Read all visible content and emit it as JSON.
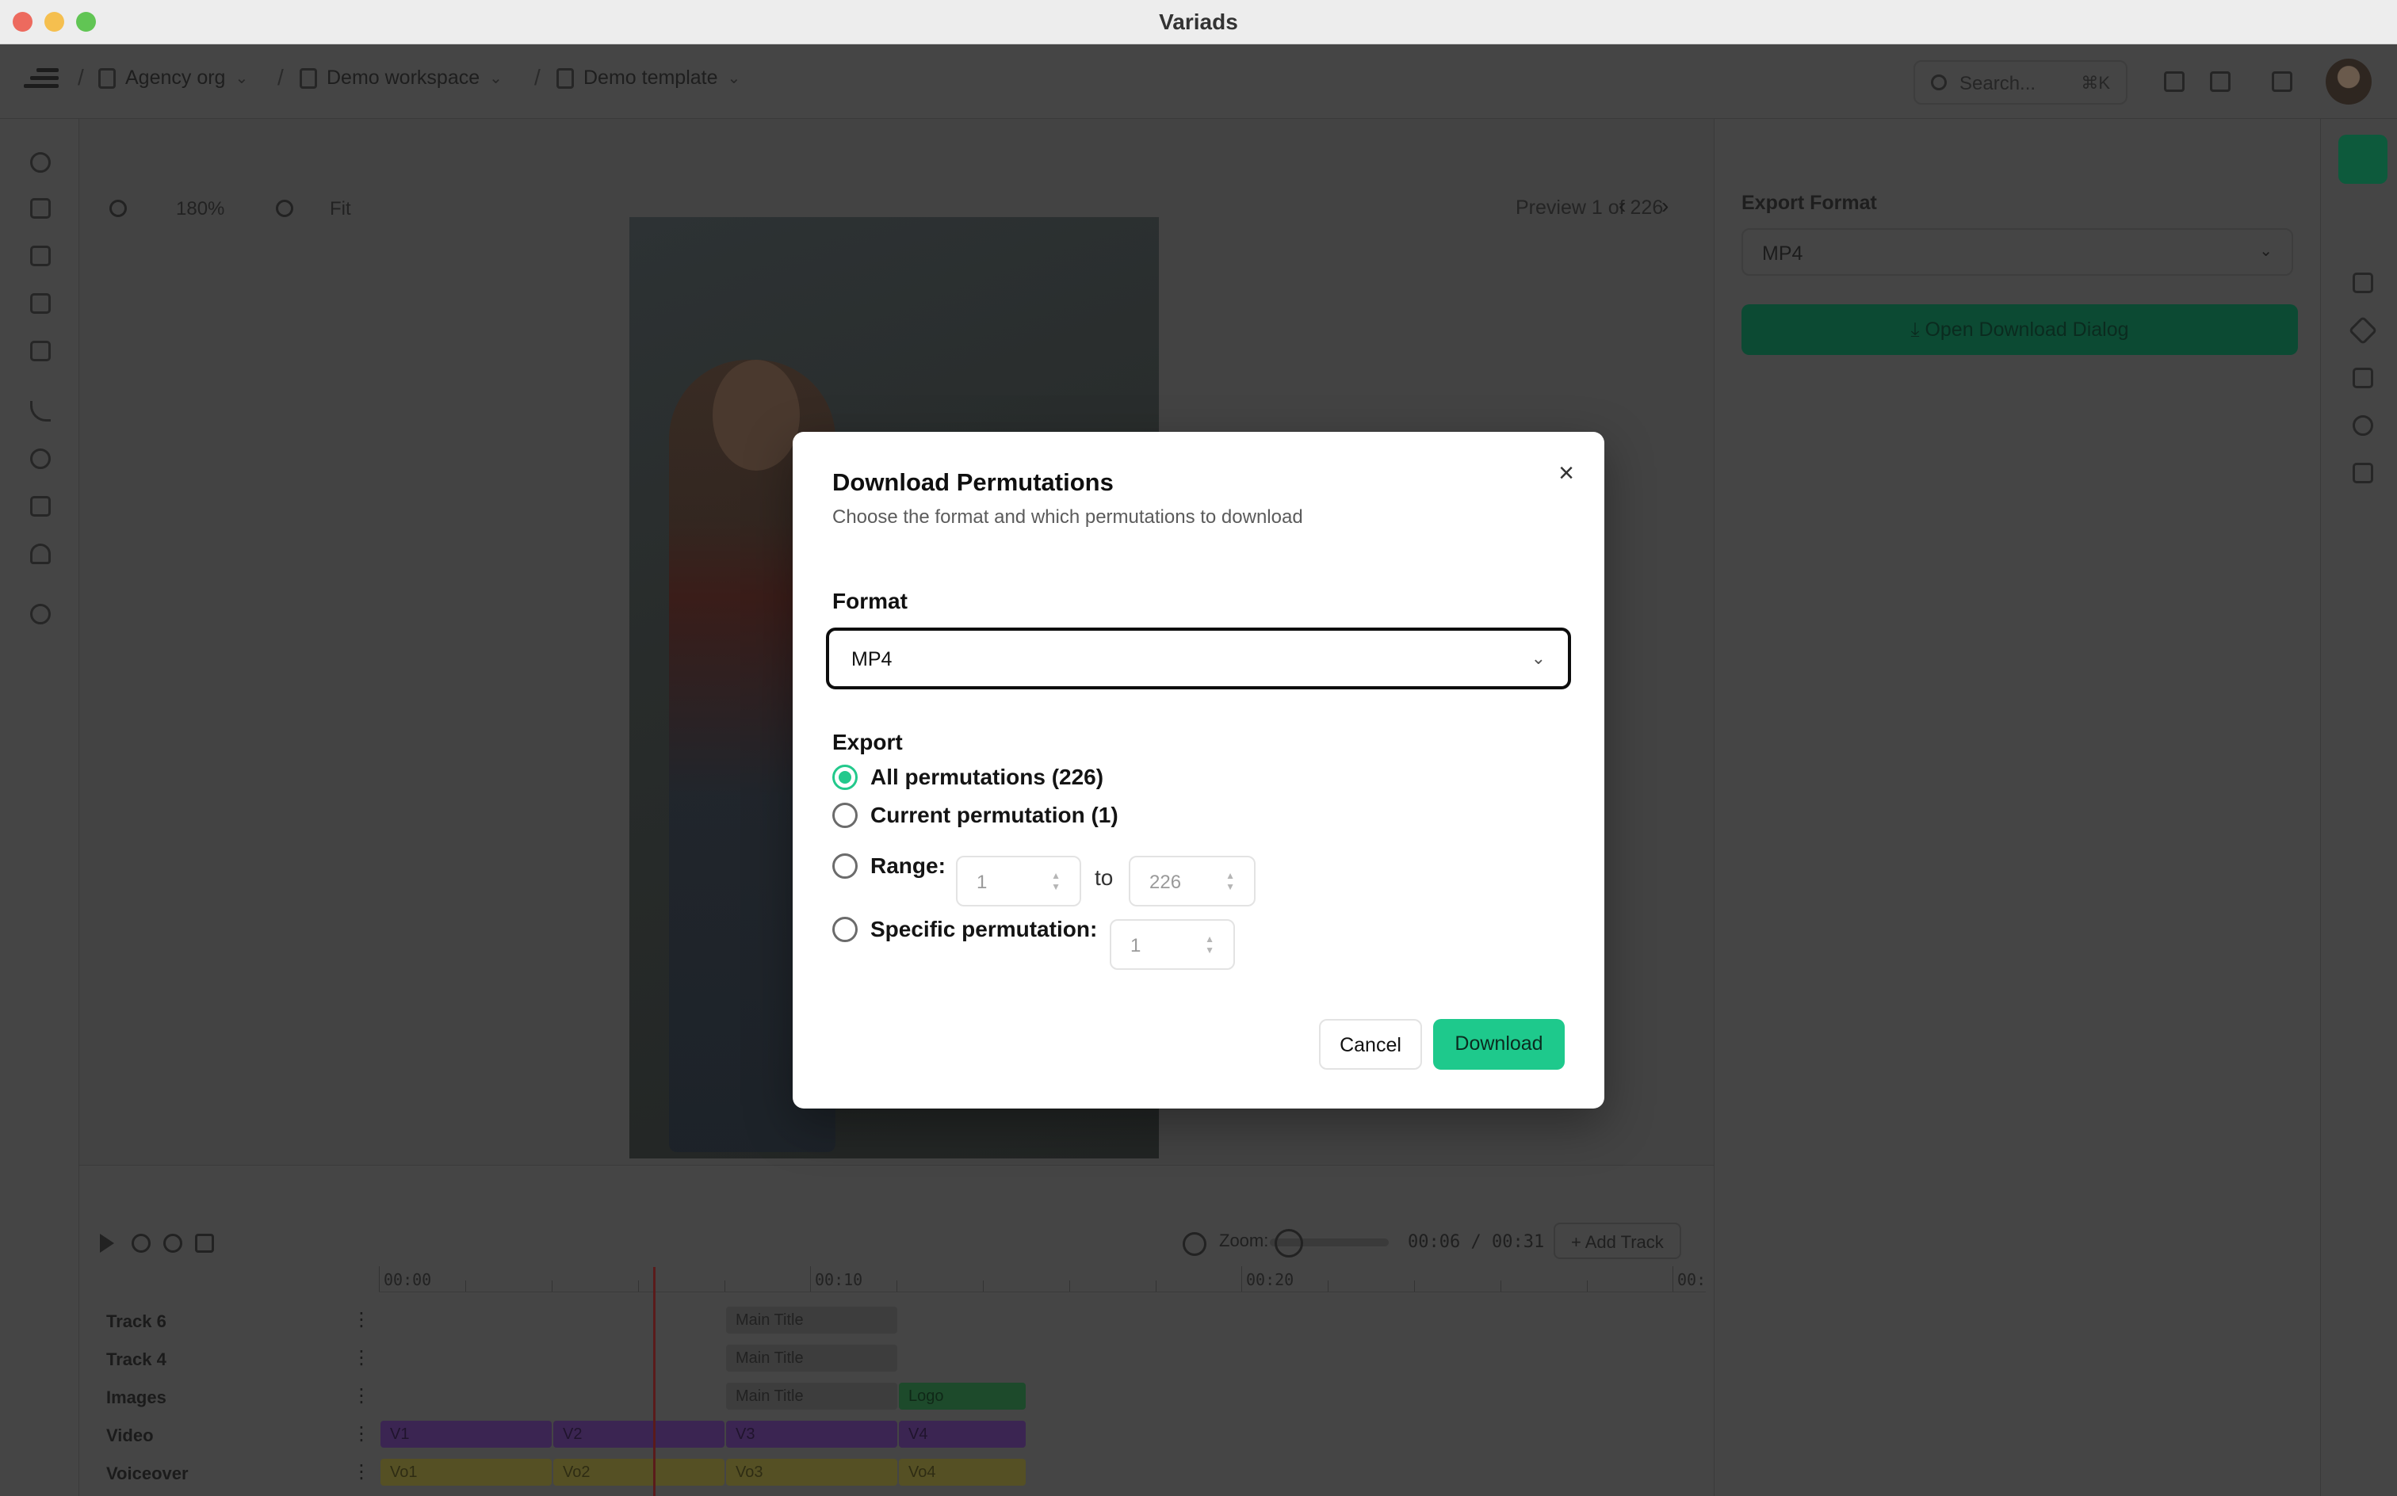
{
  "window": {
    "title": "Variads"
  },
  "topbar": {
    "breadcrumbs": [
      {
        "label": "Agency org",
        "icon": "building-icon"
      },
      {
        "label": "Demo workspace",
        "icon": "cube-icon"
      },
      {
        "label": "Demo template",
        "icon": "file-icon"
      }
    ],
    "search_placeholder": "Search...",
    "search_shortcut": "⌘K"
  },
  "canvas": {
    "zoom_level": "180%",
    "fit_label": "Fit",
    "preview_label": "Preview 1 of 226",
    "prev_glyph": "‹",
    "next_glyph": "›"
  },
  "right_panel": {
    "title": "Export Format",
    "format_value": "MP4",
    "open_dialog_label": "Open Download Dialog"
  },
  "timeline": {
    "zoom_label": "Zoom:",
    "time_readout": "00:06 / 00:31",
    "add_track_label": "Add Track",
    "ruler_labels": [
      "00:00",
      "00:10",
      "00:20",
      "00:"
    ],
    "tracks": [
      {
        "name": "Track 6",
        "clips": [
          {
            "label": "Main Title"
          }
        ]
      },
      {
        "name": "Track 4",
        "clips": [
          {
            "label": "Main Title"
          }
        ]
      },
      {
        "name": "Images",
        "clips": [
          {
            "label": "Main Title"
          },
          {
            "label": "Logo"
          }
        ]
      },
      {
        "name": "Video",
        "clips": [
          {
            "label": "V1"
          },
          {
            "label": "V2"
          },
          {
            "label": "V3"
          },
          {
            "label": "V4"
          }
        ]
      },
      {
        "name": "Voiceover",
        "clips": [
          {
            "label": "Vo1"
          },
          {
            "label": "Vo2"
          },
          {
            "label": "Vo3"
          },
          {
            "label": "Vo4"
          }
        ]
      }
    ]
  },
  "dialog": {
    "title": "Download Permutations",
    "description": "Choose the format and which permutations to download",
    "format_label": "Format",
    "format_value": "MP4",
    "export_label": "Export",
    "options": {
      "all": "All permutations (226)",
      "current": "Current permutation (1)",
      "range": "Range:",
      "specific": "Specific permutation:"
    },
    "selected_option": "all",
    "range_from": "1",
    "range_to_label": "to",
    "range_to": "226",
    "specific_value": "1",
    "cancel_label": "Cancel",
    "download_label": "Download"
  },
  "colors": {
    "accent_green": "#1ec98c",
    "overlay_dim": "#444444"
  }
}
